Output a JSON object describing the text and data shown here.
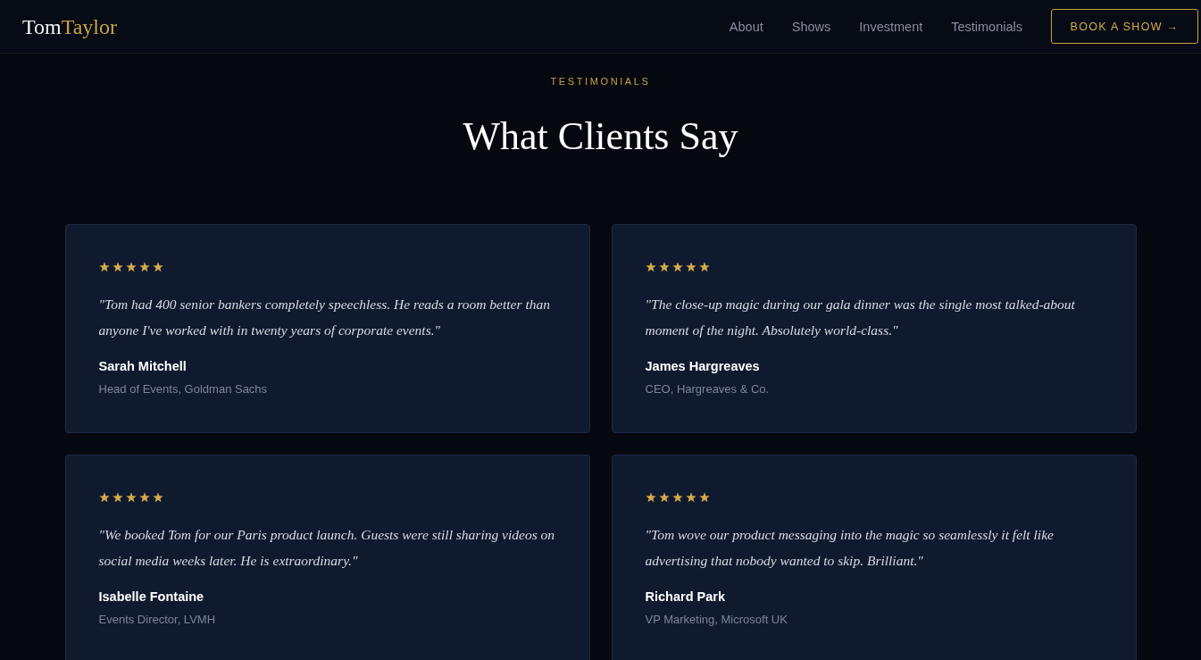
{
  "header": {
    "logo": {
      "first": "Tom",
      "second": "Taylor"
    },
    "nav": [
      "About",
      "Shows",
      "Investment",
      "Testimonials"
    ],
    "cta": "BOOK A SHOW →"
  },
  "section": {
    "eyebrow": "TESTIMONIALS",
    "title": "What Clients Say"
  },
  "testimonials": [
    {
      "stars": 5,
      "quote": "\"Tom had 400 senior bankers completely speechless. He reads a room better than anyone I've worked with in twenty years of corporate events.\"",
      "name": "Sarah Mitchell",
      "role": "Head of Events, Goldman Sachs"
    },
    {
      "stars": 5,
      "quote": "\"The close-up magic during our gala dinner was the single most talked-about moment of the night. Absolutely world-class.\"",
      "name": "James Hargreaves",
      "role": "CEO, Hargreaves & Co."
    },
    {
      "stars": 5,
      "quote": "\"We booked Tom for our Paris product launch. Guests were still sharing videos on social media weeks later. He is extraordinary.\"",
      "name": "Isabelle Fontaine",
      "role": "Events Director, LVMH"
    },
    {
      "stars": 5,
      "quote": "\"Tom wove our product messaging into the magic so seamlessly it felt like advertising that nobody wanted to skip. Brilliant.\"",
      "name": "Richard Park",
      "role": "VP Marketing, Microsoft UK"
    }
  ]
}
